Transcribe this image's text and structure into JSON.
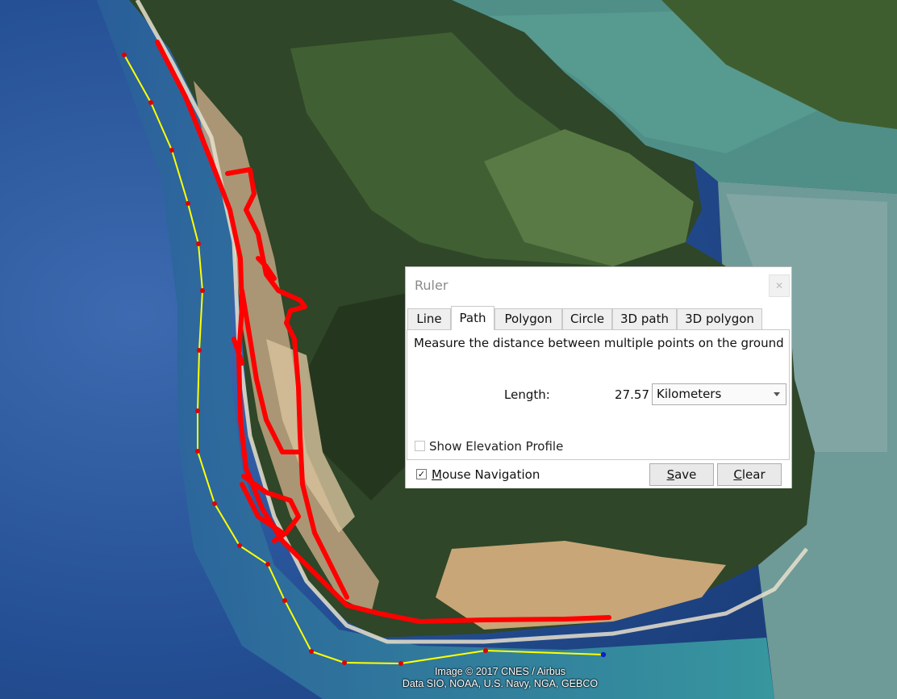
{
  "map": {
    "attribution_line1": "Image © 2017 CNES / Airbus",
    "attribution_line2": "Data SIO, NOAA, U.S. Navy, NGA, GEBCO"
  },
  "ruler_dialog": {
    "title": "Ruler",
    "close_icon": "close-icon",
    "tabs": [
      {
        "label": "Line",
        "active": false
      },
      {
        "label": "Path",
        "active": true
      },
      {
        "label": "Polygon",
        "active": false
      },
      {
        "label": "Circle",
        "active": false
      },
      {
        "label": "3D path",
        "active": false
      },
      {
        "label": "3D polygon",
        "active": false
      }
    ],
    "description": "Measure the distance between multiple points on the ground",
    "length_label": "Length:",
    "length_value": "27.57",
    "unit_selected": "Kilometers",
    "show_elevation_label": "Show Elevation Profile",
    "show_elevation_checked": false,
    "mouse_navigation_label": "Mouse Navigation",
    "mouse_navigation_checked": true,
    "save_label": "Save",
    "clear_label": "Clear"
  },
  "colors": {
    "path_line": "#ffff00",
    "path_vertex": "#e00000",
    "path_end_vertex": "#1020c0",
    "gps_track": "#ff0000"
  }
}
